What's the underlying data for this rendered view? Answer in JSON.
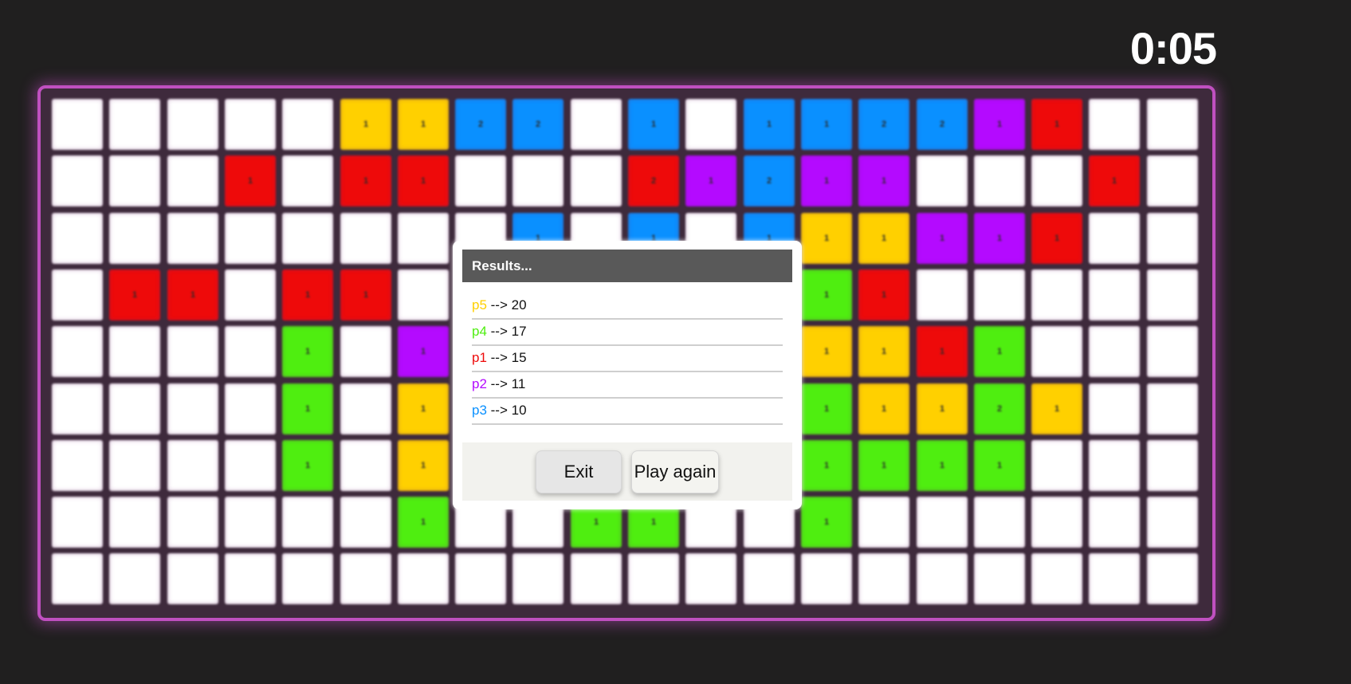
{
  "timer": "0:05",
  "colors": {
    "empty": "#ffffff",
    "yellow": "#ffd000",
    "blue": "#0a90ff",
    "red": "#ee0a0a",
    "purple": "#b40aff",
    "green": "#4fee10"
  },
  "board": {
    "rows": 9,
    "cols": 20,
    "cells": [
      [
        ".",
        ".",
        ".",
        ".",
        ".",
        "Y1",
        "Y1",
        "B2",
        "B2",
        ".",
        "B1",
        ".",
        "B1",
        "B1",
        "B2",
        "B2",
        "P1",
        "R1",
        ".",
        "."
      ],
      [
        ".",
        ".",
        ".",
        "R1",
        ".",
        "R1",
        "R1",
        ".",
        ".",
        ".",
        "R2",
        "P1",
        "B2",
        "P1",
        "P1",
        ".",
        ".",
        ".",
        "R1",
        "."
      ],
      [
        ".",
        ".",
        ".",
        ".",
        ".",
        ".",
        ".",
        ".",
        "B1",
        ".",
        "B1",
        ".",
        "B1",
        "Y1",
        "Y1",
        "P1",
        "P1",
        "R1",
        ".",
        "."
      ],
      [
        ".",
        "R1",
        "R1",
        ".",
        "R1",
        "R1",
        ".",
        ".",
        ".",
        ".",
        ".",
        ".",
        ".",
        "G1",
        "R1",
        ".",
        ".",
        ".",
        ".",
        "."
      ],
      [
        ".",
        ".",
        ".",
        ".",
        "G1",
        ".",
        "P1",
        ".",
        ".",
        ".",
        ".",
        ".",
        ".",
        "Y1",
        "Y1",
        "R1",
        "G1",
        ".",
        ".",
        "."
      ],
      [
        ".",
        ".",
        ".",
        ".",
        "G1",
        ".",
        "Y1",
        ".",
        ".",
        ".",
        ".",
        ".",
        ".",
        "G1",
        "Y1",
        "Y1",
        "G2",
        "Y1",
        ".",
        "."
      ],
      [
        ".",
        ".",
        ".",
        ".",
        "G1",
        ".",
        "Y1",
        ".",
        ".",
        ".",
        ".",
        ".",
        ".",
        "G1",
        "G1",
        "G1",
        "G1",
        ".",
        ".",
        "."
      ],
      [
        ".",
        ".",
        ".",
        ".",
        ".",
        ".",
        "G1",
        ".",
        ".",
        "G1",
        "G1",
        ".",
        ".",
        "G1",
        ".",
        ".",
        ".",
        ".",
        ".",
        "."
      ],
      [
        ".",
        ".",
        ".",
        ".",
        ".",
        ".",
        ".",
        ".",
        ".",
        ".",
        ".",
        ".",
        ".",
        ".",
        ".",
        ".",
        ".",
        ".",
        ".",
        "."
      ]
    ]
  },
  "results": {
    "title": "Results...",
    "rows": [
      {
        "player": "p5",
        "arrow": " --> ",
        "score": "20",
        "color": "#ffd000"
      },
      {
        "player": "p4",
        "arrow": " --> ",
        "score": "17",
        "color": "#4fee10"
      },
      {
        "player": "p1",
        "arrow": " --> ",
        "score": "15",
        "color": "#ee0a0a"
      },
      {
        "player": "p2",
        "arrow": " --> ",
        "score": "11",
        "color": "#b40aff"
      },
      {
        "player": "p3",
        "arrow": " --> ",
        "score": "10",
        "color": "#0a90ff"
      }
    ],
    "exit_label": "Exit",
    "play_again_label": "Play again"
  }
}
